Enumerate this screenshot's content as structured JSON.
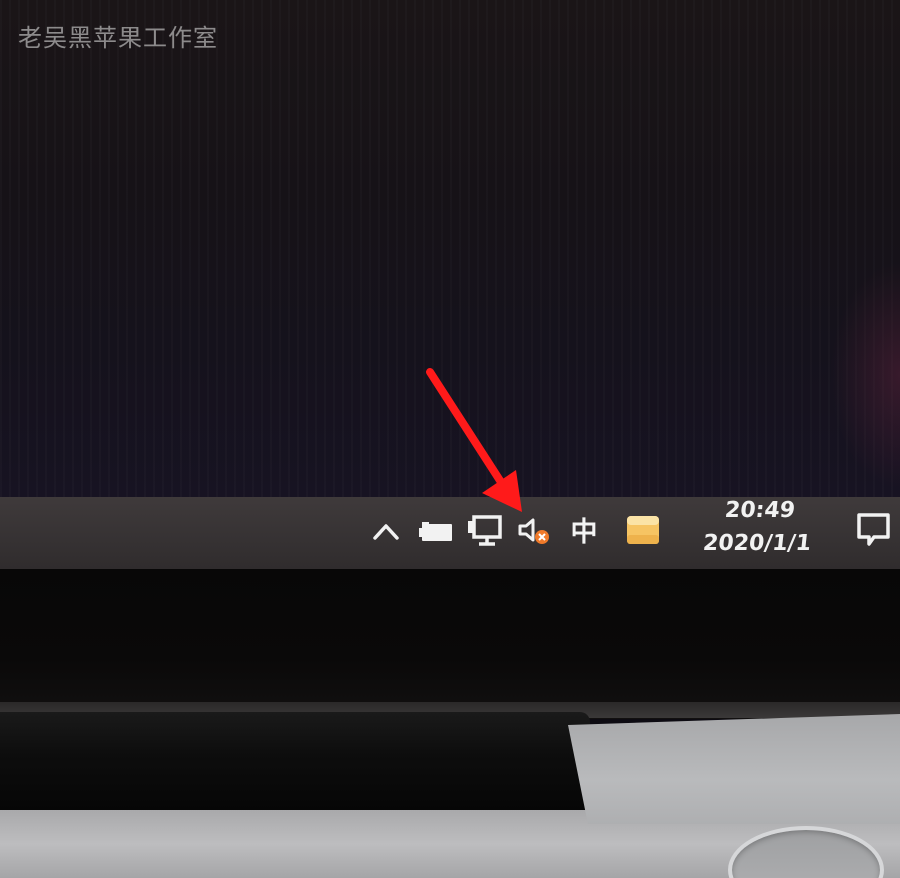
{
  "watermark": "老吴黑苹果工作室",
  "taskbar": {
    "tray": {
      "show_hidden_icons": "chevron-up-icon",
      "battery": "battery-icon",
      "network": "network-monitor-icon",
      "volume": "volume-muted-icon",
      "ime_label": "中",
      "app": "sticky-notes-icon"
    },
    "clock": {
      "time": "20:49",
      "date": "2020/1/1"
    },
    "notifications": "action-center-icon"
  },
  "colors": {
    "taskbar": "#3a3536",
    "annotation_arrow": "#ff1a1a",
    "mute_badge": "#f07a2a",
    "app_icon": "#f6c463"
  }
}
